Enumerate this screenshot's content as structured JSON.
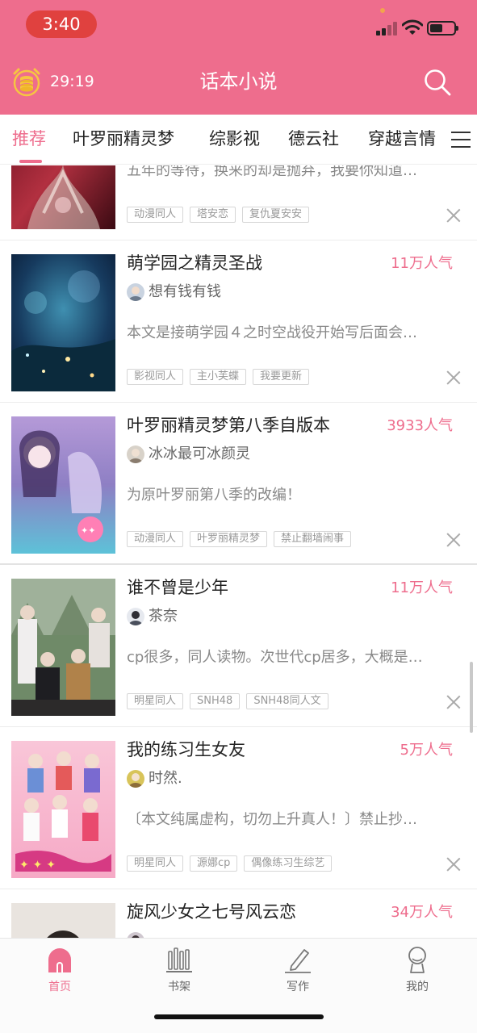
{
  "colors": {
    "accent": "#ee6d8d",
    "time_pill": "#e0413f",
    "header_bg": "#ee6d8d"
  },
  "status_bar": {
    "time": "3:40"
  },
  "header": {
    "timer": "29:19",
    "title": "话本小说",
    "left_icon": "alarm-coin-icon",
    "right_icon": "search-icon"
  },
  "tabs": [
    {
      "label": "推荐",
      "active": true
    },
    {
      "label": "叶罗丽精灵梦",
      "active": false
    },
    {
      "label": "综影视",
      "active": false
    },
    {
      "label": "德云社",
      "active": false
    },
    {
      "label": "穿越言情",
      "active": false
    }
  ],
  "books": [
    {
      "title": "",
      "popularity": "",
      "author": "",
      "description": "五年的等待，换来的却是抛弃，我要你知道…",
      "tags": [
        "动漫同人",
        "塔安恋",
        "复仇夏安安"
      ]
    },
    {
      "title": "萌学园之精灵圣战",
      "popularity": "11万人气",
      "author": "想有钱有钱",
      "description": "本文是接萌学园４之时空战役开始写后面会…",
      "tags": [
        "影视同人",
        "主小芙蝶",
        "我要更新"
      ]
    },
    {
      "title": "叶罗丽精灵梦第八季自版本",
      "popularity": "3933人气",
      "author": "冰冰最可冰颜灵",
      "description": "为原叶罗丽第八季的改编！",
      "tags": [
        "动漫同人",
        "叶罗丽精灵梦",
        "禁止翻墙闹事"
      ]
    },
    {
      "title": "谁不曾是少年",
      "popularity": "11万人气",
      "author": "茶奈",
      "description": "cp很多，同人读物。次世代cp居多，大概是…",
      "tags": [
        "明星同人",
        "SNH48",
        "SNH48同人文"
      ]
    },
    {
      "title": "我的练习生女友",
      "popularity": "5万人气",
      "author": "时然.",
      "description": "〔本文纯属虚构，切勿上升真人！〕禁止抄…",
      "tags": [
        "明星同人",
        "源娜cp",
        "偶像练习生综艺"
      ]
    },
    {
      "title": "旋风少女之七号风云恋",
      "popularity": "34万人气",
      "author": "",
      "description": "",
      "tags": []
    }
  ],
  "bottom_nav": [
    {
      "label": "首页",
      "icon": "home-arch-icon",
      "active": true
    },
    {
      "label": "书架",
      "icon": "bookshelf-icon",
      "active": false
    },
    {
      "label": "写作",
      "icon": "pen-icon",
      "active": false
    },
    {
      "label": "我的",
      "icon": "profile-icon",
      "active": false
    }
  ]
}
